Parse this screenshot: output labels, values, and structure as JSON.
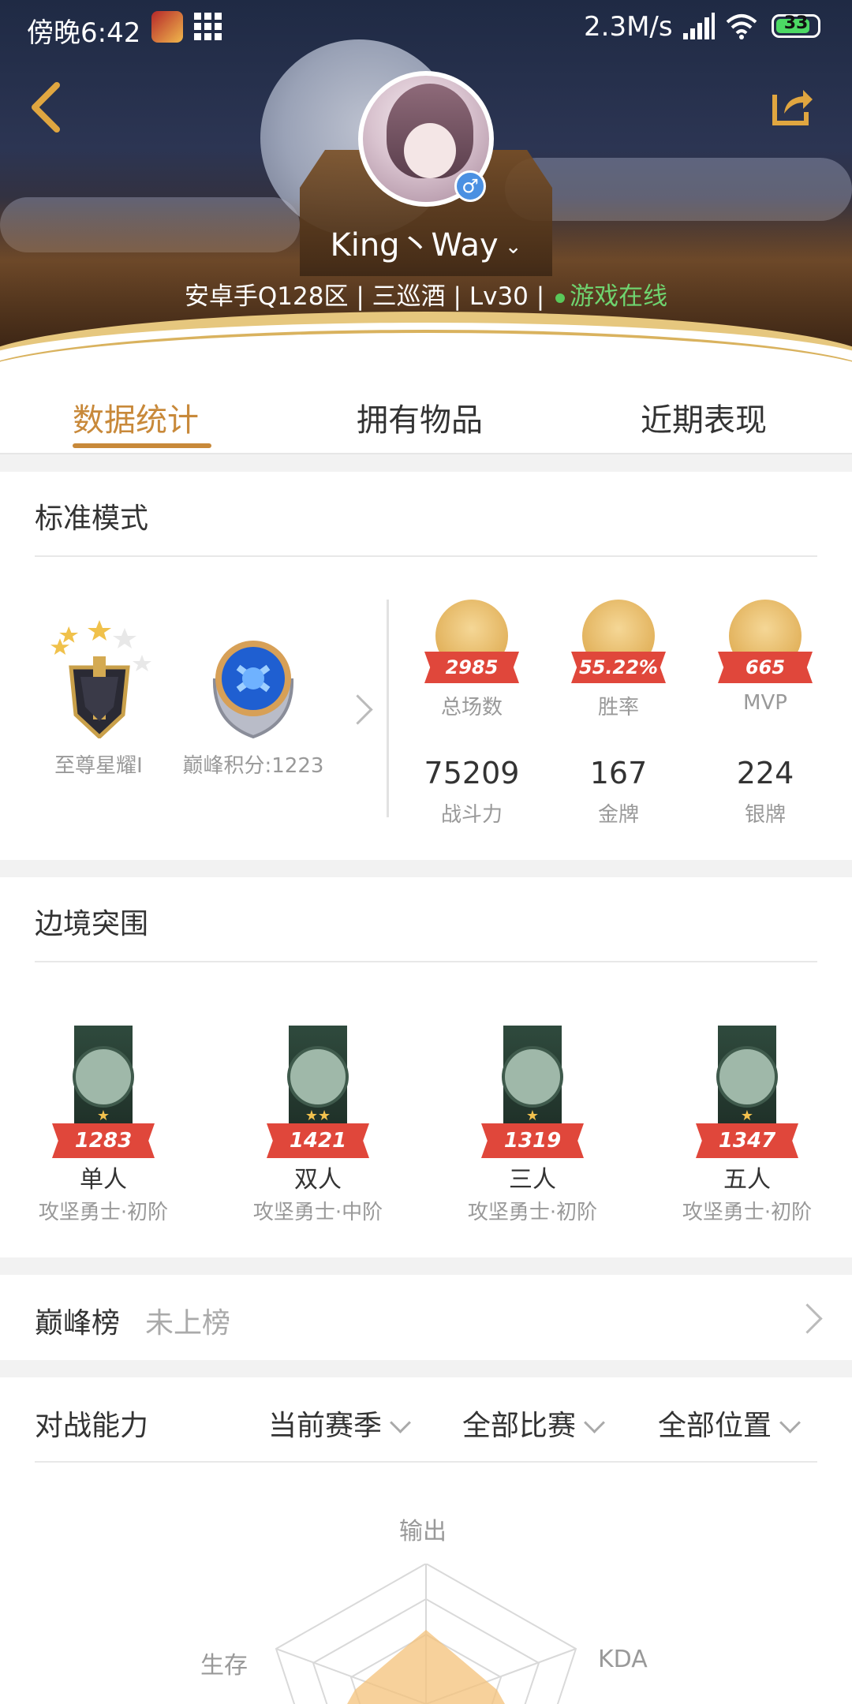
{
  "status_bar": {
    "time": "傍晚6:42",
    "net_speed": "2.3M/s",
    "battery": "33"
  },
  "profile": {
    "username": "King丶Way",
    "server": "安卓手Q128区",
    "nickname": "三巡酒",
    "level": "Lv30",
    "separator": "|",
    "online_status": "游戏在线"
  },
  "tabs": [
    {
      "label": "数据统计"
    },
    {
      "label": "拥有物品"
    },
    {
      "label": "近期表现"
    }
  ],
  "standard_mode": {
    "title": "标准模式",
    "rank_name": "至尊星耀I",
    "peak_score": "巅峰积分:1223",
    "medals": [
      {
        "value": "2985",
        "label": "总场数"
      },
      {
        "value": "55.22%",
        "label": "胜率"
      },
      {
        "value": "665",
        "label": "MVP"
      }
    ],
    "stats": [
      {
        "value": "75209",
        "label": "战斗力"
      },
      {
        "value": "167",
        "label": "金牌"
      },
      {
        "value": "224",
        "label": "银牌"
      }
    ]
  },
  "border_breakthrough": {
    "title": "边境突围",
    "modes": [
      {
        "score": "1283",
        "name": "单人",
        "rank": "攻坚勇士·初阶",
        "stars": "★"
      },
      {
        "score": "1421",
        "name": "双人",
        "rank": "攻坚勇士·中阶",
        "stars": "★★"
      },
      {
        "score": "1319",
        "name": "三人",
        "rank": "攻坚勇士·初阶",
        "stars": "★"
      },
      {
        "score": "1347",
        "name": "五人",
        "rank": "攻坚勇士·初阶",
        "stars": "★"
      }
    ]
  },
  "peak_board": {
    "label": "巅峰榜",
    "value": "未上榜"
  },
  "battle_ability": {
    "title": "对战能力",
    "filters": [
      "当前赛季",
      "全部比赛",
      "全部位置"
    ],
    "radar_labels": {
      "top": "输出",
      "left": "生存",
      "right": "KDA"
    }
  },
  "colors": {
    "accent": "#c8893a",
    "online": "#6fd36f",
    "ribbon": "#e0473b"
  }
}
